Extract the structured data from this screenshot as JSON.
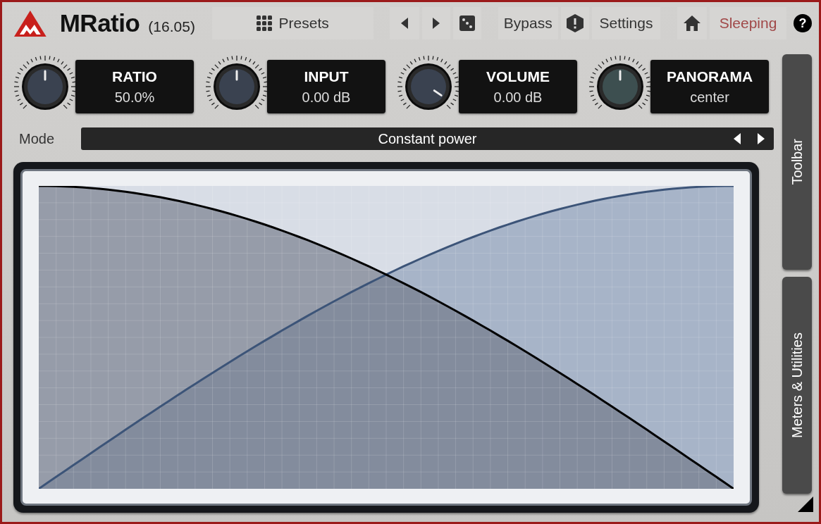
{
  "header": {
    "title": "MRatio",
    "version": "(16.05)",
    "presets": "Presets",
    "bypass": "Bypass",
    "settings": "Settings",
    "status": "Sleeping",
    "help": "?"
  },
  "knobs": [
    {
      "label": "RATIO",
      "value": "50.0%",
      "level": 0.5,
      "color": "#3a4250"
    },
    {
      "label": "INPUT",
      "value": "0.00 dB",
      "level": 0.5,
      "color": "#3a4250"
    },
    {
      "label": "VOLUME",
      "value": "0.00 dB",
      "level": 0.96,
      "color": "#3a4250"
    },
    {
      "label": "PANORAMA",
      "value": "center",
      "level": 0.5,
      "color": "#3d4f50"
    }
  ],
  "mode": {
    "label": "Mode",
    "value": "Constant power"
  },
  "side_tabs": [
    {
      "label": "Toolbar"
    },
    {
      "label": "Meters & Utilities"
    }
  ]
}
